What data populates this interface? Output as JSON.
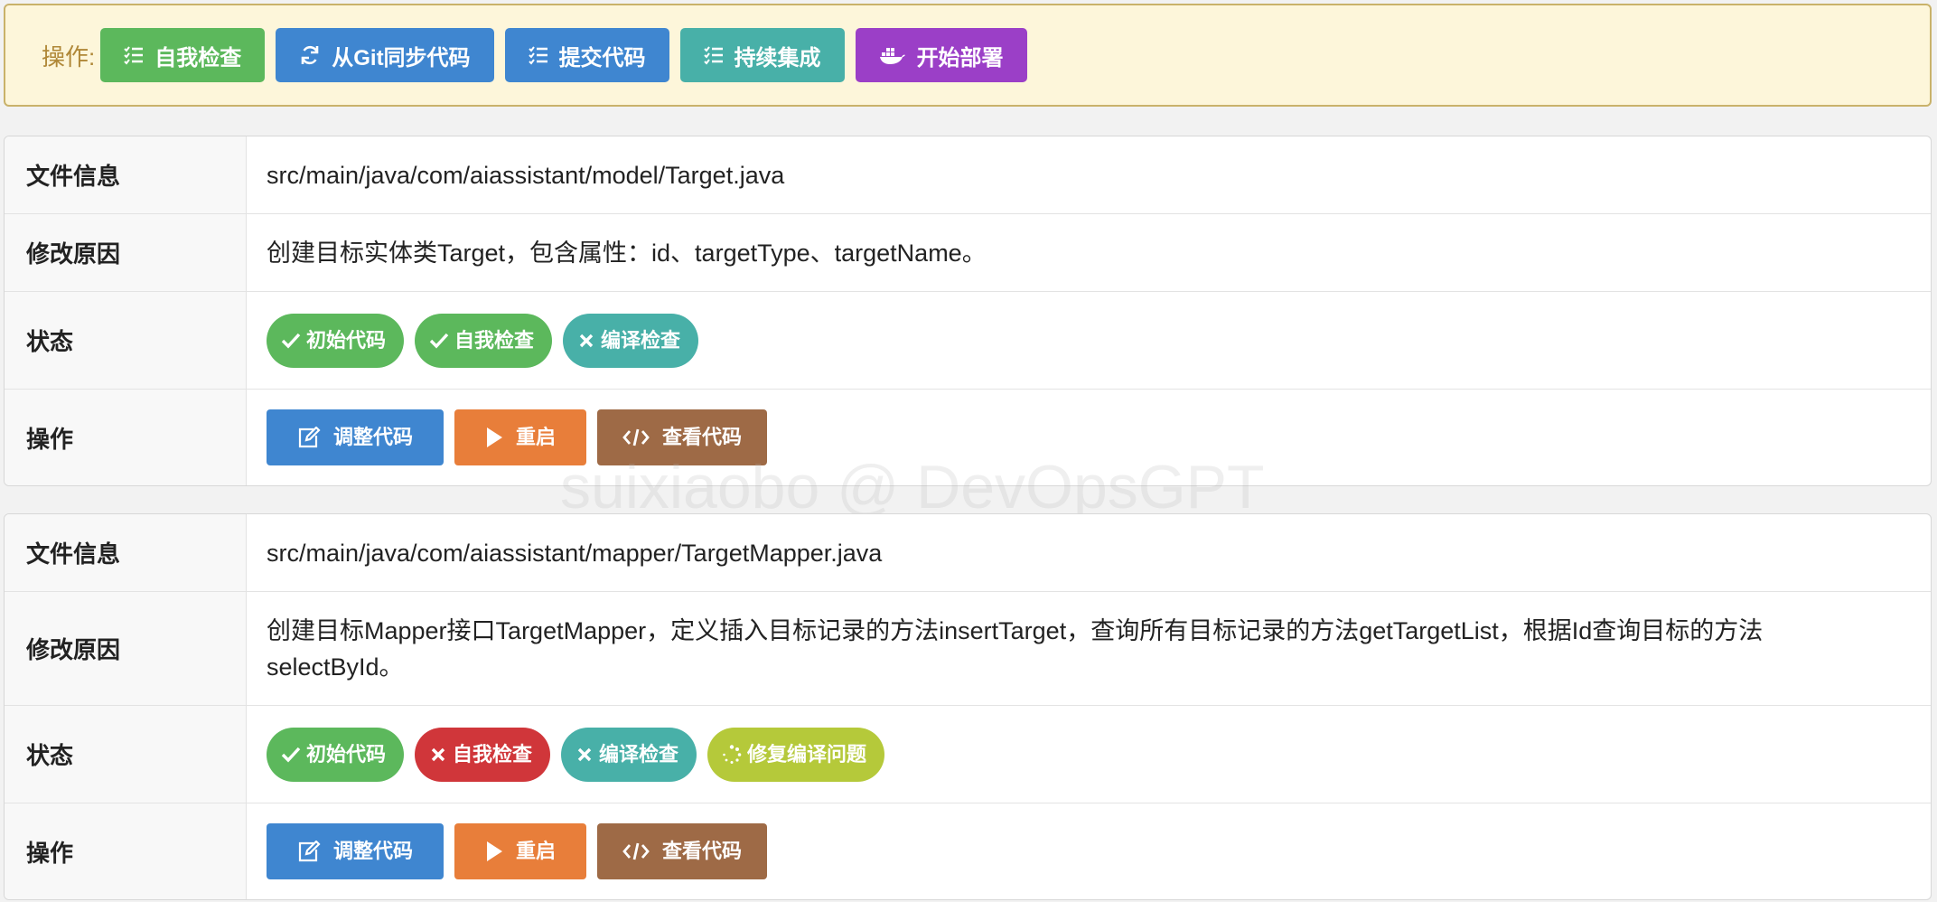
{
  "toolbar": {
    "label": "操作:",
    "buttons": [
      {
        "label": "自我检查",
        "icon": "list-check-icon",
        "color": "#5cb85c"
      },
      {
        "label": "从Git同步代码",
        "icon": "sync-icon",
        "color": "#3f86d0"
      },
      {
        "label": "提交代码",
        "icon": "list-check-icon",
        "color": "#3f86d0"
      },
      {
        "label": "持续集成",
        "icon": "list-check-icon",
        "color": "#48b0a8"
      },
      {
        "label": "开始部署",
        "icon": "docker-icon",
        "color": "#9b3fc7"
      }
    ]
  },
  "labels": {
    "file_info": "文件信息",
    "reason": "修改原因",
    "status": "状态",
    "actions": "操作"
  },
  "cards": [
    {
      "file": "src/main/java/com/aiassistant/model/Target.java",
      "reason": "创建目标实体类Target，包含属性：id、targetType、targetName。",
      "status": [
        {
          "label": "初始代码",
          "icon": "check-icon",
          "color": "#5cb85c"
        },
        {
          "label": "自我检查",
          "icon": "check-icon",
          "color": "#5cb85c"
        },
        {
          "label": "编译检查",
          "icon": "times-icon",
          "color": "#48b0a8"
        }
      ],
      "actions": [
        {
          "label": "调整代码",
          "icon": "edit-icon",
          "color": "#3f86d0"
        },
        {
          "label": "重启",
          "icon": "play-icon",
          "color": "#e87e3a"
        },
        {
          "label": "查看代码",
          "icon": "code-icon",
          "color": "#9e6a46"
        }
      ]
    },
    {
      "file": "src/main/java/com/aiassistant/mapper/TargetMapper.java",
      "reason": "创建目标Mapper接口TargetMapper，定义插入目标记录的方法insertTarget，查询所有目标记录的方法getTargetList，根据Id查询目标的方法selectById。",
      "status": [
        {
          "label": "初始代码",
          "icon": "check-icon",
          "color": "#5cb85c"
        },
        {
          "label": "自我检查",
          "icon": "times-icon",
          "color": "#d0363a"
        },
        {
          "label": "编译检查",
          "icon": "times-icon",
          "color": "#48b0a8"
        },
        {
          "label": "修复编译问题",
          "icon": "spinner-icon",
          "color": "#b5c93a"
        }
      ],
      "actions": [
        {
          "label": "调整代码",
          "icon": "edit-icon",
          "color": "#3f86d0"
        },
        {
          "label": "重启",
          "icon": "play-icon",
          "color": "#e87e3a"
        },
        {
          "label": "查看代码",
          "icon": "code-icon",
          "color": "#9e6a46"
        }
      ]
    }
  ],
  "watermark": "suixiaobo @ DevOpsGPT"
}
